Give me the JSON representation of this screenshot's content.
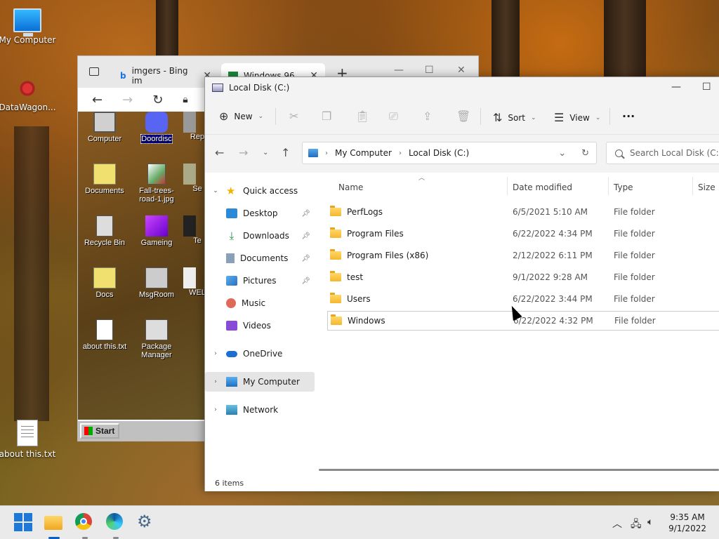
{
  "desktop": {
    "icons": [
      {
        "label": "My Computer"
      },
      {
        "label": "DataWagon..."
      },
      {
        "label": "about this.txt"
      }
    ]
  },
  "browser": {
    "tabs": [
      {
        "label": "imgers - Bing im"
      },
      {
        "label": "Windows 96"
      }
    ],
    "win96_desktop": {
      "icons": [
        {
          "label": "Computer"
        },
        {
          "label": "Doordisc"
        },
        {
          "label": "Rep"
        },
        {
          "label": "Documents"
        },
        {
          "label": "Fall-trees-road-1.jpg"
        },
        {
          "label": "Se"
        },
        {
          "label": "Recycle Bin"
        },
        {
          "label": "Gameing"
        },
        {
          "label": "Te"
        },
        {
          "label": "Docs"
        },
        {
          "label": "MsgRoom"
        },
        {
          "label": "WEL"
        },
        {
          "label": "about this.txt"
        },
        {
          "label": "Package Manager"
        }
      ],
      "start_label": "Start"
    }
  },
  "explorer": {
    "title": "Local Disk (C:)",
    "commands": {
      "new": "New",
      "sort": "Sort",
      "view": "View",
      "more": "···"
    },
    "breadcrumb": [
      "My Computer",
      "Local Disk (C:)"
    ],
    "search_placeholder": "Search Local Disk (C:)",
    "sidebar": {
      "quick_access": "Quick access",
      "pinned": [
        {
          "label": "Desktop"
        },
        {
          "label": "Downloads"
        },
        {
          "label": "Documents"
        },
        {
          "label": "Pictures"
        },
        {
          "label": "Music"
        },
        {
          "label": "Videos"
        }
      ],
      "onedrive": "OneDrive",
      "my_computer": "My Computer",
      "network": "Network"
    },
    "columns": {
      "name": "Name",
      "date": "Date modified",
      "type": "Type",
      "size": "Size"
    },
    "files": [
      {
        "name": "PerfLogs",
        "date": "6/5/2021 5:10 AM",
        "type": "File folder"
      },
      {
        "name": "Program Files",
        "date": "6/22/2022 4:34 PM",
        "type": "File folder"
      },
      {
        "name": "Program Files (x86)",
        "date": "2/12/2022 6:11 PM",
        "type": "File folder"
      },
      {
        "name": "test",
        "date": "9/1/2022 9:28 AM",
        "type": "File folder"
      },
      {
        "name": "Users",
        "date": "6/22/2022 3:44 PM",
        "type": "File folder"
      },
      {
        "name": "Windows",
        "date": "6/22/2022 4:32 PM",
        "type": "File folder"
      }
    ],
    "status": "6 items"
  },
  "taskbar": {
    "time": "9:35 AM",
    "date": "9/1/2022"
  },
  "colors": {
    "accent": "#0a5fc8",
    "folder": "#f5b72e"
  }
}
